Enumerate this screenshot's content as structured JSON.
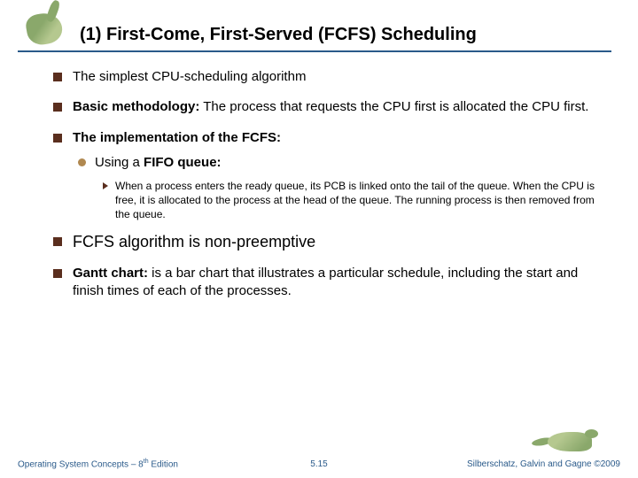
{
  "title": "(1) First-Come, First-Served (FCFS) Scheduling",
  "bullets": {
    "b1": "The simplest CPU-scheduling algorithm",
    "b2_label": "Basic methodology:",
    "b2_text": " The process that requests the CPU first is allocated the CPU first.",
    "b3": "The implementation of the FCFS:",
    "b3_sub_label": "Using a ",
    "b3_sub_bold": "FIFO queue:",
    "b3_subsub": "When a process enters the ready queue, its PCB is linked onto the tail of the queue. When the CPU is free, it is allocated to the process at the head of the queue. The running process is then removed from the queue.",
    "b4": "FCFS  algorithm is non-preemptive",
    "b5_label": "Gantt chart:",
    "b5_text": " is a bar chart that illustrates a particular schedule, including the start and finish times of each of the processes."
  },
  "footer": {
    "left_a": "Operating System Concepts – 8",
    "left_b": " Edition",
    "left_sup": "th",
    "center": "5.15",
    "right_a": "Silberschatz, Galvin and Gagne ",
    "right_b": "2009",
    "right_c": "©"
  }
}
